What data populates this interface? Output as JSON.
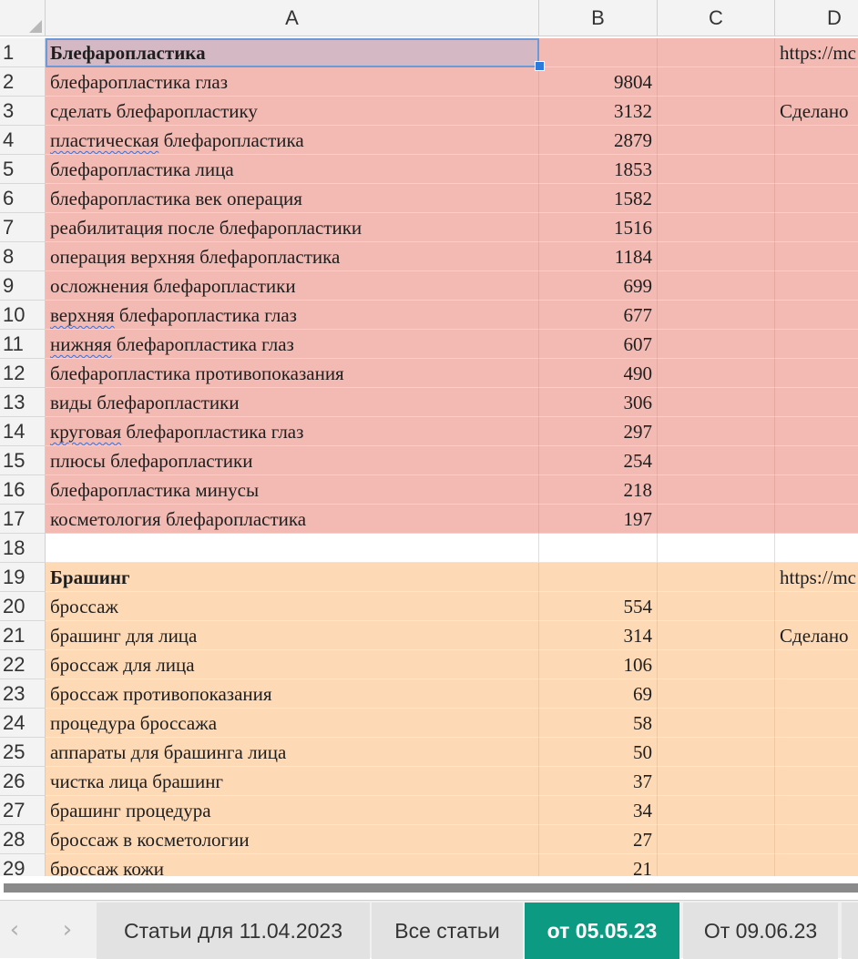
{
  "columns": [
    "A",
    "B",
    "C",
    "D"
  ],
  "rows": [
    {
      "n": "1",
      "a": "Блефаропластика",
      "b": "",
      "d": "https://mc",
      "bold": true,
      "group": "pink",
      "selected": true
    },
    {
      "n": "2",
      "a": "блефаропластика глаз",
      "b": "9804",
      "d": "",
      "group": "pink"
    },
    {
      "n": "3",
      "a": "сделать блефаропластику",
      "b": "3132",
      "d": "Сделано",
      "group": "pink"
    },
    {
      "n": "4",
      "a": "пластическая блефаропластика",
      "b": "2879",
      "d": "",
      "group": "pink",
      "squiggle": "пластическая"
    },
    {
      "n": "5",
      "a": "блефаропластика лица",
      "b": "1853",
      "d": "",
      "group": "pink"
    },
    {
      "n": "6",
      "a": "блефаропластика век операция",
      "b": "1582",
      "d": "",
      "group": "pink"
    },
    {
      "n": "7",
      "a": "реабилитация после блефаропластики",
      "b": "1516",
      "d": "",
      "group": "pink"
    },
    {
      "n": "8",
      "a": "операция верхняя блефаропластика",
      "b": "1184",
      "d": "",
      "group": "pink"
    },
    {
      "n": "9",
      "a": "осложнения блефаропластики",
      "b": "699",
      "d": "",
      "group": "pink"
    },
    {
      "n": "10",
      "a": "верхняя блефаропластика глаз",
      "b": "677",
      "d": "",
      "group": "pink",
      "squiggle": "верхняя"
    },
    {
      "n": "11",
      "a": "нижняя блефаропластика глаз",
      "b": "607",
      "d": "",
      "group": "pink",
      "squiggle": "нижняя"
    },
    {
      "n": "12",
      "a": "блефаропластика противопоказания",
      "b": "490",
      "d": "",
      "group": "pink"
    },
    {
      "n": "13",
      "a": "виды блефаропластики",
      "b": "306",
      "d": "",
      "group": "pink"
    },
    {
      "n": "14",
      "a": "круговая блефаропластика глаз",
      "b": "297",
      "d": "",
      "group": "pink",
      "squiggle": "круговая"
    },
    {
      "n": "15",
      "a": "плюсы блефаропластики",
      "b": "254",
      "d": "",
      "group": "pink"
    },
    {
      "n": "16",
      "a": "блефаропластика минусы",
      "b": "218",
      "d": "",
      "group": "pink"
    },
    {
      "n": "17",
      "a": "косметология блефаропластика",
      "b": "197",
      "d": "",
      "group": "pink"
    },
    {
      "n": "18",
      "a": "",
      "b": "",
      "d": "",
      "group": "white"
    },
    {
      "n": "19",
      "a": "Брашинг",
      "b": "",
      "d": "https://mc",
      "bold": true,
      "group": "peach"
    },
    {
      "n": "20",
      "a": "броссаж",
      "b": "554",
      "d": "",
      "group": "peach"
    },
    {
      "n": "21",
      "a": "брашинг для лица",
      "b": "314",
      "d": "Сделано",
      "group": "peach"
    },
    {
      "n": "22",
      "a": "броссаж для лица",
      "b": "106",
      "d": "",
      "group": "peach"
    },
    {
      "n": "23",
      "a": "броссаж противопоказания",
      "b": "69",
      "d": "",
      "group": "peach"
    },
    {
      "n": "24",
      "a": "процедура броссажа",
      "b": "58",
      "d": "",
      "group": "peach"
    },
    {
      "n": "25",
      "a": "аппараты для брашинга лица",
      "b": "50",
      "d": "",
      "group": "peach"
    },
    {
      "n": "26",
      "a": "чистка лица брашинг",
      "b": "37",
      "d": "",
      "group": "peach"
    },
    {
      "n": "27",
      "a": "брашинг процедура",
      "b": "34",
      "d": "",
      "group": "peach"
    },
    {
      "n": "28",
      "a": "броссаж в косметологии",
      "b": "27",
      "d": "",
      "group": "peach"
    },
    {
      "n": "29",
      "a": "броссаж кожи",
      "b": "21",
      "d": "",
      "group": "peach"
    }
  ],
  "sheet_tabs": [
    {
      "label": "Статьи для 11.04.2023",
      "active": false
    },
    {
      "label": "Все статьи",
      "active": false
    },
    {
      "label": "от 05.05.23",
      "active": true
    },
    {
      "label": "От 09.06.23",
      "active": false
    }
  ],
  "nav": {
    "prev_icon": "‹",
    "next_icon": "›"
  },
  "colors": {
    "pink": "#f2bab3",
    "peach": "#fdd9b6",
    "active_tab": "#0d9a82",
    "selection": "#2a7bdc"
  }
}
